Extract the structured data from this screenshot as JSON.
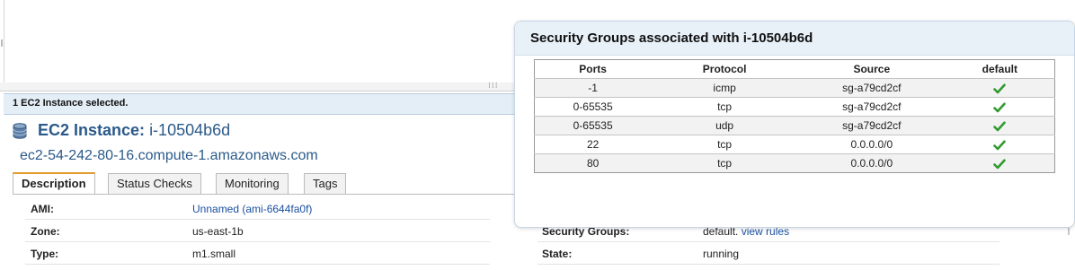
{
  "selection": {
    "text": "1 EC2 Instance selected."
  },
  "instance": {
    "title_prefix": "EC2 Instance:",
    "id": "i-10504b6d",
    "dns": "ec2-54-242-80-16.compute-1.amazonaws.com"
  },
  "tabs": [
    {
      "label": "Description",
      "active": true
    },
    {
      "label": "Status Checks",
      "active": false
    },
    {
      "label": "Monitoring",
      "active": false
    },
    {
      "label": "Tags",
      "active": false
    }
  ],
  "details": {
    "ami": {
      "label": "AMI:",
      "value": "Unnamed (ami-6644fa0f)"
    },
    "zone": {
      "label": "Zone:",
      "value": "us-east-1b"
    },
    "type": {
      "label": "Type:",
      "value": "m1.small"
    },
    "security_groups": {
      "label": "Security Groups:",
      "value": "default.",
      "link": "view rules"
    },
    "state": {
      "label": "State:",
      "value": "running"
    }
  },
  "popup": {
    "title": "Security Groups associated with i-10504b6d",
    "columns": [
      "Ports",
      "Protocol",
      "Source",
      "default"
    ],
    "rows": [
      {
        "ports": "-1",
        "protocol": "icmp",
        "source": "sg-a79cd2cf",
        "default": "check-icon"
      },
      {
        "ports": "0-65535",
        "protocol": "tcp",
        "source": "sg-a79cd2cf",
        "default": "check-icon"
      },
      {
        "ports": "0-65535",
        "protocol": "udp",
        "source": "sg-a79cd2cf",
        "default": "check-icon"
      },
      {
        "ports": "22",
        "protocol": "tcp",
        "source": "0.0.0.0/0",
        "default": "check-icon"
      },
      {
        "ports": "80",
        "protocol": "tcp",
        "source": "0.0.0.0/0",
        "default": "check-icon"
      }
    ]
  },
  "colors": {
    "link": "#1a4fa0",
    "title": "#2b5a8a",
    "active_tab_accent": "#e59a2a",
    "check": "#2e9a2e"
  }
}
